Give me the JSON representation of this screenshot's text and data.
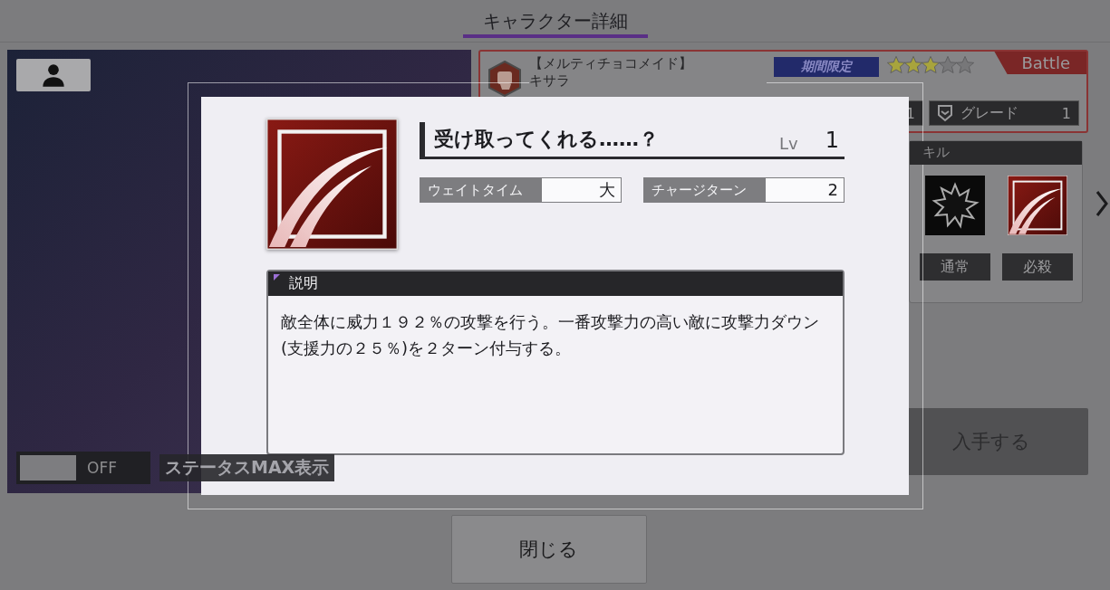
{
  "header": {
    "title": "キャラクター詳細"
  },
  "art_panel": {
    "toggle": {
      "label": "OFF",
      "on": false
    },
    "caption": "ステータスMAX表示"
  },
  "character_card": {
    "title_line": "【メルティチョコメイド】",
    "name": "キサラ",
    "tag": "期間限定",
    "stars": 3,
    "type": "Battle",
    "level_value": "1",
    "grade": {
      "label": "グレード",
      "value": "1"
    }
  },
  "skill_panel": {
    "title": "キル",
    "skills": [
      {
        "label": "通常",
        "kind": "normal"
      },
      {
        "label": "必殺",
        "kind": "special"
      }
    ]
  },
  "acquire_button": "入手する",
  "dialog": {
    "skill_name": "受け取ってくれる……？",
    "level_label": "Lv",
    "level": "1",
    "stats": [
      {
        "label": "ウェイトタイム",
        "value": "大"
      },
      {
        "label": "チャージターン",
        "value": "2"
      }
    ],
    "section_title": "説明",
    "description": "敵全体に威力１９２％の攻撃を行う。一番攻撃力の高い敵に攻撃力ダウン(支援力の２５％)を２ターン付与する。"
  },
  "close_button": "閉じる"
}
